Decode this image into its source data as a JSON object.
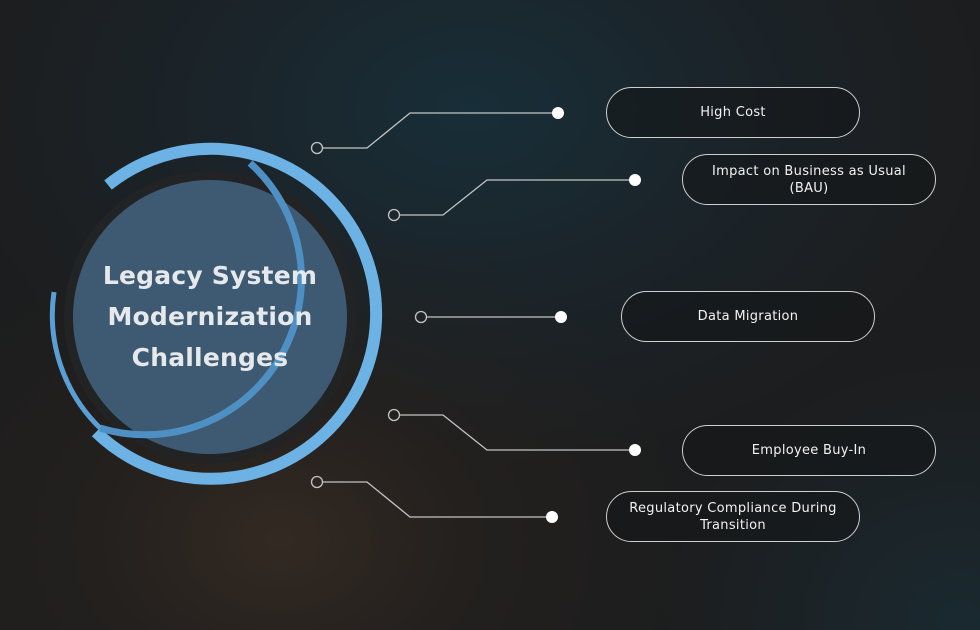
{
  "title": {
    "lines": [
      "Legacy System",
      "Modernization",
      "Challenges"
    ]
  },
  "challenges": [
    {
      "label": "High Cost"
    },
    {
      "label": "Impact on Business as Usual (BAU)"
    },
    {
      "label": "Data Migration"
    },
    {
      "label": "Employee Buy-In"
    },
    {
      "label": "Regulatory Compliance During Transition"
    }
  ],
  "colors": {
    "ring_light": "#6cb2e4",
    "ring_dark": "#4f90c4",
    "center_fill": "#3e5a72",
    "ring_gap": "#222324",
    "connector": "#c4c4c4",
    "dot": "#ffffff",
    "pill_border": "#cfcfcf",
    "text": "#f2f2f2"
  }
}
